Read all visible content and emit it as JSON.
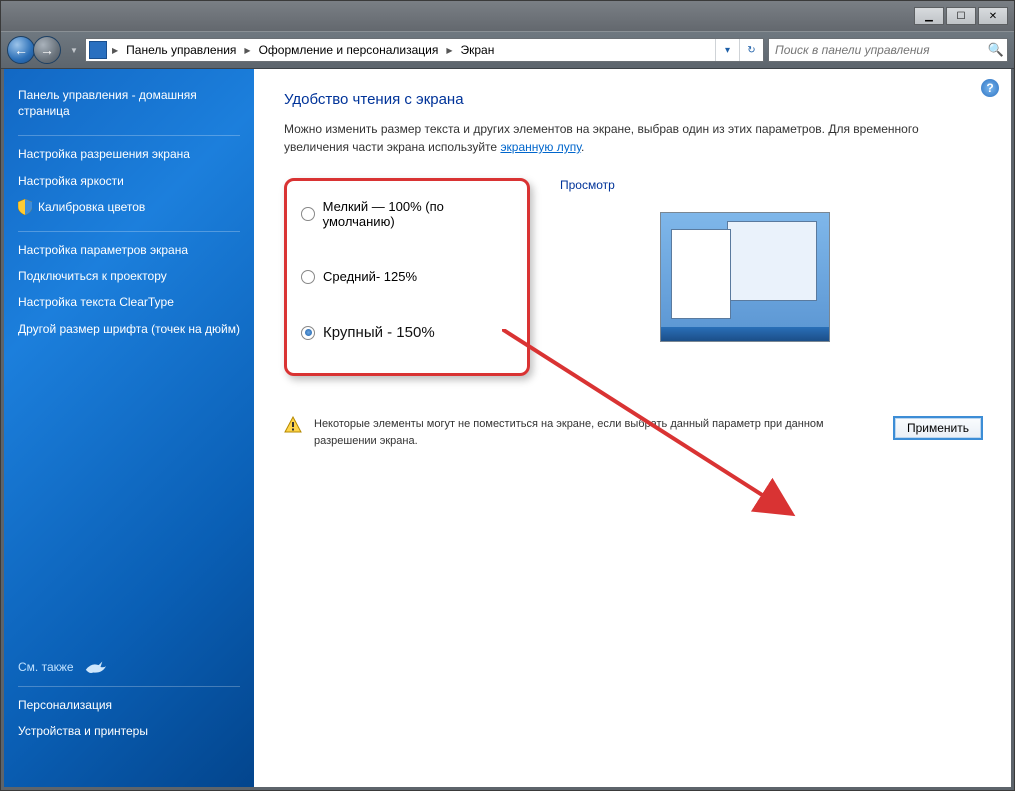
{
  "breadcrumb": {
    "seg1": "Панель управления",
    "seg2": "Оформление и персонализация",
    "seg3": "Экран"
  },
  "search": {
    "placeholder": "Поиск в панели управления"
  },
  "sidebar": {
    "home": "Панель управления - домашняя страница",
    "links": [
      "Настройка разрешения экрана",
      "Настройка яркости",
      "Калибровка цветов",
      "Настройка параметров экрана",
      "Подключиться к проектору",
      "Настройка текста ClearType",
      "Другой размер шрифта (точек на дюйм)"
    ],
    "see_also": "См. также",
    "bottom": [
      "Персонализация",
      "Устройства и принтеры"
    ]
  },
  "main": {
    "title": "Удобство чтения с экрана",
    "desc_a": "Можно изменить размер текста и других элементов на экране, выбрав один из этих параметров. Для временного увеличения части экрана используйте ",
    "desc_link": "экранную лупу",
    "desc_b": ".",
    "radios": {
      "small": "Мелкий — 100% (по умолчанию)",
      "medium": "Средний- 125%",
      "large": "Крупный - 150%"
    },
    "preview": "Просмотр",
    "warning": "Некоторые элементы могут не поместиться на экране, если выбрать данный параметр при данном разрешении экрана.",
    "apply": "Применить"
  }
}
